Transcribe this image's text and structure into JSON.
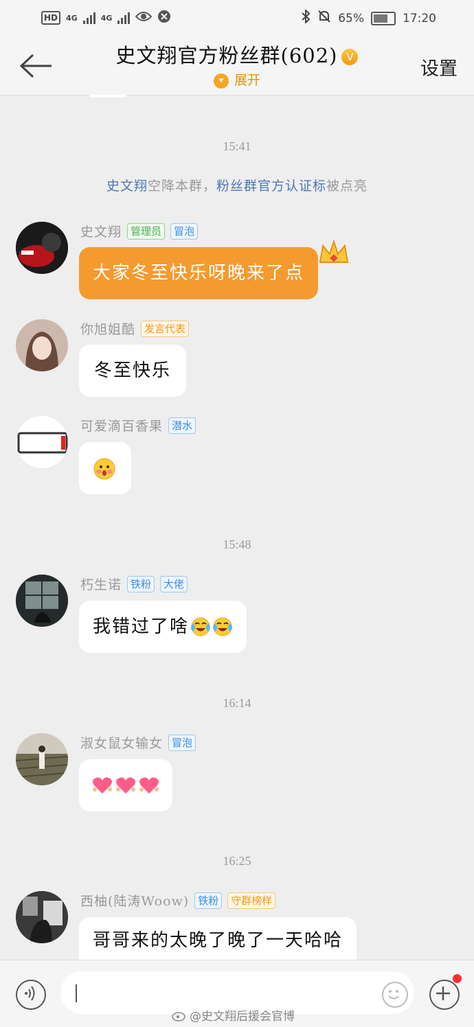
{
  "status_bar": {
    "network_left": [
      "HD",
      "4G",
      "4G"
    ],
    "battery": "65%",
    "time": "17:20"
  },
  "header": {
    "title": "史文翔官方粉丝群(602)",
    "verified_icon": "v-badge-icon",
    "expand_label": "展开",
    "settings_label": "设置",
    "back_icon": "arrow-left-icon"
  },
  "messages": {
    "t1": "15:41",
    "system": {
      "name": "史文翔",
      "text1": "空降本群，",
      "tag": "粉丝群官方认证标",
      "text2": "被点亮"
    },
    "m1": {
      "nick": "史文翔",
      "tags": [
        "管理员",
        "冒泡"
      ],
      "text": "大家冬至快乐呀晚来了点"
    },
    "m2": {
      "nick": "你旭姐酷",
      "tags": [
        "发言代表"
      ],
      "text": "冬至快乐"
    },
    "m3": {
      "nick": "可爱滴百香果",
      "tags": [
        "潜水"
      ],
      "emoji": "shy-face-emoji"
    },
    "t2": "15:48",
    "m4": {
      "nick": "朽生诺",
      "tags": [
        "铁粉",
        "大佬"
      ],
      "text": "我错过了啥",
      "emoji": "crying-laughing-emoji"
    },
    "t3": "16:14",
    "m5": {
      "nick": "淑女鼠女输女",
      "tags": [
        "冒泡"
      ],
      "emoji": "heart-emoji"
    },
    "t4": "16:25",
    "m6": {
      "nick": "西柚(陆涛Woow)",
      "tags": [
        "铁粉",
        "守群榜样"
      ],
      "text": "哥哥来的太晚了晚了一天哈哈"
    }
  },
  "input_bar": {
    "voice_icon": "voice-icon",
    "emoji_icon": "smile-icon",
    "plus_icon": "plus-icon"
  },
  "watermark": "@史文翔后援会官博",
  "colors": {
    "accent": "#f59a2e",
    "bg": "#eeeeee",
    "link": "#4b78b8"
  }
}
